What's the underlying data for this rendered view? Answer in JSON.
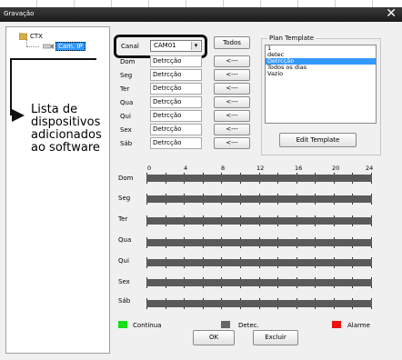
{
  "window": {
    "title": "Gravação",
    "close_glyph": "✕"
  },
  "tree": {
    "root": "CTX",
    "camera": "Cam. IP"
  },
  "annotation": {
    "lines": [
      "Lista de",
      "dispositivos",
      "adicionados",
      "ao software"
    ]
  },
  "canal": {
    "label": "Canal",
    "value": "CAM01",
    "arrow": "▾"
  },
  "buttons": {
    "todos": "Todos",
    "copy": "<---",
    "edit_template": "Edit Template",
    "ok": "OK",
    "excluir": "Excluir"
  },
  "days": [
    {
      "abbr": "Dom",
      "template": "Detrcção"
    },
    {
      "abbr": "Seg",
      "template": "Detrcção"
    },
    {
      "abbr": "Ter",
      "template": "Detrcção"
    },
    {
      "abbr": "Qua",
      "template": "Detrcção"
    },
    {
      "abbr": "Qui",
      "template": "Detrcção"
    },
    {
      "abbr": "Sex",
      "template": "Detrcção"
    },
    {
      "abbr": "Sáb",
      "template": "Detrcção"
    }
  ],
  "plan_template": {
    "title": "Plan Template",
    "items": [
      "1",
      "detec",
      "Detrcção",
      "Todos os dias",
      "Vazio"
    ],
    "selected_index": 2
  },
  "timeline": {
    "hours": [
      "0",
      "4",
      "8",
      "12",
      "16",
      "20",
      "24"
    ]
  },
  "legend": {
    "continua": {
      "label": "Continua",
      "color": "#16e016"
    },
    "detec": {
      "label": "Detec.",
      "color": "#666666"
    },
    "alarme": {
      "label": "Alarme",
      "color": "#ee1111"
    }
  }
}
